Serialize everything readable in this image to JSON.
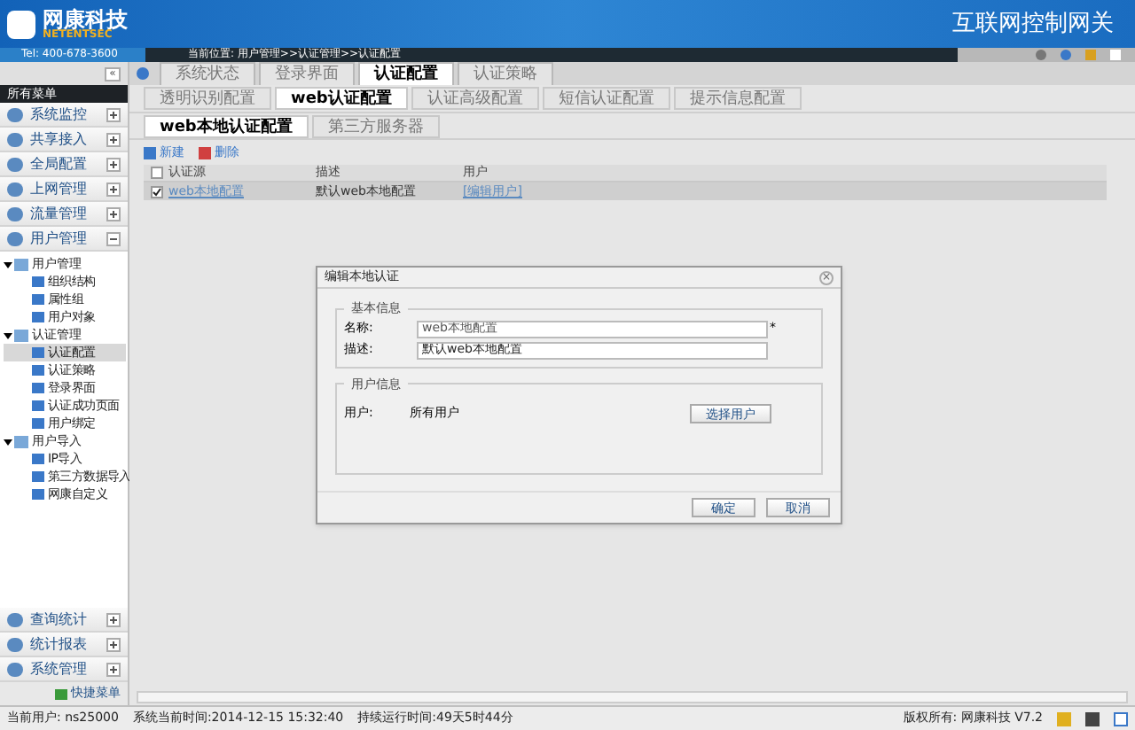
{
  "header": {
    "logo_cn": "网康科技",
    "logo_en": "NETENTSEC",
    "tel": "Tel: 400-678-3600",
    "product": "互联网控制网关",
    "location": "当前位置: 用户管理>>认证管理>>认证配置"
  },
  "sidebar": {
    "title": "所有菜单",
    "collapse": "«",
    "top_menus": [
      {
        "label": "系统监控",
        "expanded": false
      },
      {
        "label": "共享接入",
        "expanded": false
      },
      {
        "label": "全局配置",
        "expanded": false
      },
      {
        "label": "上网管理",
        "expanded": false
      },
      {
        "label": "流量管理",
        "expanded": false
      },
      {
        "label": "用户管理",
        "expanded": true
      }
    ],
    "tree": [
      {
        "label": "用户管理",
        "expanded": true,
        "children": [
          {
            "label": "组织结构",
            "selected": false
          },
          {
            "label": "属性组",
            "selected": false
          },
          {
            "label": "用户对象",
            "selected": false
          }
        ]
      },
      {
        "label": "认证管理",
        "expanded": true,
        "children": [
          {
            "label": "认证配置",
            "selected": true
          },
          {
            "label": "认证策略",
            "selected": false
          },
          {
            "label": "登录界面",
            "selected": false
          },
          {
            "label": "认证成功页面",
            "selected": false
          },
          {
            "label": "用户绑定",
            "selected": false
          }
        ]
      },
      {
        "label": "用户导入",
        "expanded": true,
        "children": [
          {
            "label": "IP导入",
            "selected": false
          },
          {
            "label": "第三方数据导入",
            "selected": false
          },
          {
            "label": "网康自定义",
            "selected": false
          }
        ]
      }
    ],
    "bottom_menus": [
      {
        "label": "查询统计",
        "expanded": false
      },
      {
        "label": "统计报表",
        "expanded": false
      },
      {
        "label": "系统管理",
        "expanded": false
      }
    ],
    "shortcut": "快捷菜单"
  },
  "page_tabs": [
    {
      "label": "系统状态",
      "selected": false
    },
    {
      "label": "登录界面",
      "selected": false
    },
    {
      "label": "认证配置",
      "selected": true
    },
    {
      "label": "认证策略",
      "selected": false
    }
  ],
  "sub_tabs": [
    {
      "label": "透明识别配置",
      "selected": false
    },
    {
      "label": "web认证配置",
      "selected": true
    },
    {
      "label": "认证高级配置",
      "selected": false
    },
    {
      "label": "短信认证配置",
      "selected": false
    },
    {
      "label": "提示信息配置",
      "selected": false
    }
  ],
  "inner_tabs": [
    {
      "label": "web本地认证配置",
      "selected": true
    },
    {
      "label": "第三方服务器",
      "selected": false
    }
  ],
  "toolbar": [
    "新建",
    "删除"
  ],
  "table": {
    "all_checked": false,
    "columns": [
      "认证源",
      "描述",
      "用户"
    ],
    "rows": [
      {
        "checked": true,
        "cells": [
          "web本地配置",
          "默认web本地配置",
          "[编辑用户]"
        ]
      }
    ]
  },
  "dialog": {
    "title": "编辑本地认证",
    "close": "×",
    "basic_section": "基本信息",
    "name_label": "名称:",
    "name_value": "web本地配置",
    "required": "*",
    "desc_label": "描述:",
    "desc_value": "默认web本地配置",
    "user_section": "用户信息",
    "user_label": "用户:",
    "user_value": "所有用户",
    "select_button": "选择用户",
    "buttons": [
      "确定",
      "取消"
    ]
  },
  "status_bar": {
    "user": "当前用户: ns25000",
    "time": "系统当前时间:2014-12-15 15:32:40",
    "uptime": "持续运行时间:49天5时44分",
    "copyright": "版权所有: 网康科技 V7.2"
  }
}
